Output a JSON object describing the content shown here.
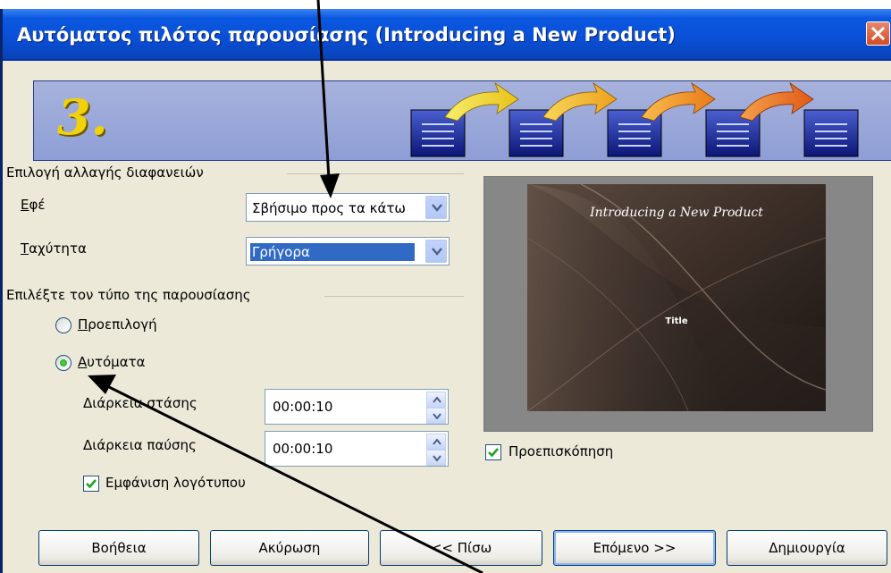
{
  "window": {
    "title": "Αυτόματος πιλότος παρουσίασης (Introducing a New Product)",
    "close_icon": "close-icon"
  },
  "banner": {
    "step": "3."
  },
  "transition_group": {
    "label": "Επιλογή αλλαγής διαφανειών",
    "effect_label": "Εφέ",
    "effect_value": "Σβήσιμο προς τα κάτω",
    "speed_label": "Ταχύτητα",
    "speed_value": "Γρήγορα"
  },
  "type_group": {
    "label": "Επιλέξτε τον τύπο της παρουσίασης",
    "default_option": "Προεπιλογή",
    "auto_option": "Αυτόματα",
    "selected": "auto",
    "duration_label": "Διάρκεια στάσης",
    "duration_value": "00:00:10",
    "pause_label": "Διάρκεια παύσης",
    "pause_value": "00:00:10",
    "show_logo_label": "Εμφάνιση λογότυπου",
    "show_logo_checked": true
  },
  "preview": {
    "slide_title": "Introducing a New Product",
    "slide_subtitle": "Title",
    "preview_label": "Προεπισκόπηση",
    "preview_checked": true
  },
  "buttons": {
    "help": "Βοήθεια",
    "cancel": "Ακύρωση",
    "back": "<< Πίσω",
    "next": "Επόμενο >>",
    "create": "Δημιουργία"
  },
  "colors": {
    "titlebar": "#0a4fd6",
    "dialog_bg": "#ece9d8",
    "banner": "#8e9ed6",
    "step_number": "#f1d10a",
    "selection": "#316ac5"
  }
}
